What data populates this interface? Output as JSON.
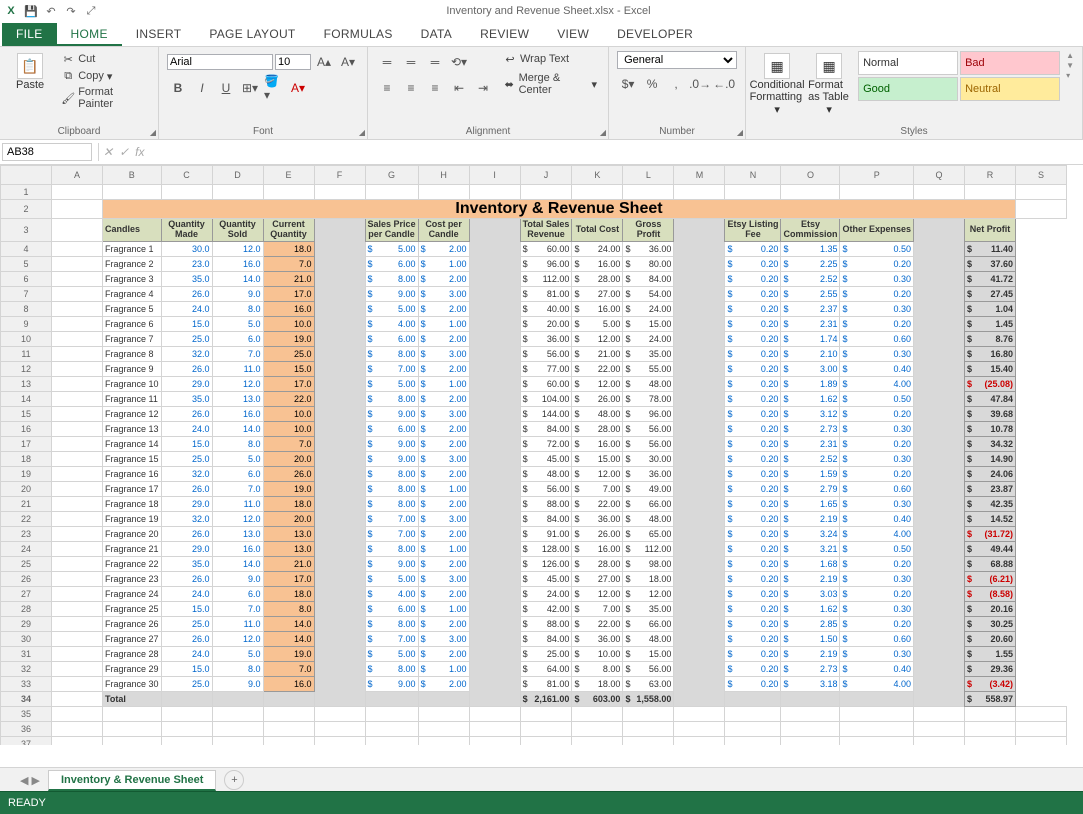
{
  "app": {
    "title": "Inventory and Revenue Sheet.xlsx - Excel",
    "qat_icons": [
      "excel-icon",
      "save-icon",
      "undo-icon",
      "redo-icon",
      "touch-icon"
    ]
  },
  "ribbon_tabs": [
    "FILE",
    "HOME",
    "INSERT",
    "PAGE LAYOUT",
    "FORMULAS",
    "DATA",
    "REVIEW",
    "VIEW",
    "DEVELOPER"
  ],
  "ribbon": {
    "clipboard": {
      "paste": "Paste",
      "cut": "Cut",
      "copy": "Copy",
      "painter": "Format Painter",
      "title": "Clipboard"
    },
    "font": {
      "name": "Arial",
      "size": "10",
      "bold": "B",
      "italic": "I",
      "underline": "U",
      "title": "Font"
    },
    "alignment": {
      "wrap": "Wrap Text",
      "merge": "Merge & Center",
      "title": "Alignment"
    },
    "number": {
      "format": "General",
      "title": "Number"
    },
    "styles": {
      "cond": "Conditional Formatting",
      "table": "Format as Table",
      "normal": "Normal",
      "bad": "Bad",
      "good": "Good",
      "neutral": "Neutral",
      "title": "Styles"
    }
  },
  "namebox": "AB38",
  "sheet": {
    "title": "Inventory & Revenue Sheet",
    "headers": [
      "Candles",
      "Quantity Made",
      "Quantity Sold",
      "Current Quantity",
      "Sales Price per Candle",
      "Cost per Candle",
      "Total Sales Revenue",
      "Total Cost",
      "Gross Profit",
      "Etsy Listing Fee",
      "Etsy Commission",
      "Other Expenses",
      "Net Profit"
    ],
    "cols": [
      "A",
      "B",
      "C",
      "D",
      "E",
      "F",
      "G",
      "H",
      "I",
      "J",
      "K",
      "L",
      "M",
      "N",
      "O",
      "P",
      "Q",
      "R",
      "S"
    ],
    "rows": [
      {
        "n": "Fragrance 1",
        "qm": 30.0,
        "qs": 12.0,
        "cq": 18.0,
        "sp": 5.0,
        "cp": 2.0,
        "rev": 60.0,
        "tc": 24.0,
        "gp": 36.0,
        "elf": 0.2,
        "ec": 1.35,
        "oe": 0.5,
        "np": 11.4
      },
      {
        "n": "Fragrance 2",
        "qm": 23.0,
        "qs": 16.0,
        "cq": 7.0,
        "sp": 6.0,
        "cp": 1.0,
        "rev": 96.0,
        "tc": 16.0,
        "gp": 80.0,
        "elf": 0.2,
        "ec": 2.25,
        "oe": 0.2,
        "np": 37.6
      },
      {
        "n": "Fragrance 3",
        "qm": 35.0,
        "qs": 14.0,
        "cq": 21.0,
        "sp": 8.0,
        "cp": 2.0,
        "rev": 112.0,
        "tc": 28.0,
        "gp": 84.0,
        "elf": 0.2,
        "ec": 2.52,
        "oe": 0.3,
        "np": 41.72
      },
      {
        "n": "Fragrance 4",
        "qm": 26.0,
        "qs": 9.0,
        "cq": 17.0,
        "sp": 9.0,
        "cp": 3.0,
        "rev": 81.0,
        "tc": 27.0,
        "gp": 54.0,
        "elf": 0.2,
        "ec": 2.55,
        "oe": 0.2,
        "np": 27.45
      },
      {
        "n": "Fragrance 5",
        "qm": 24.0,
        "qs": 8.0,
        "cq": 16.0,
        "sp": 5.0,
        "cp": 2.0,
        "rev": 40.0,
        "tc": 16.0,
        "gp": 24.0,
        "elf": 0.2,
        "ec": 2.37,
        "oe": 0.3,
        "np": 1.04
      },
      {
        "n": "Fragrance 6",
        "qm": 15.0,
        "qs": 5.0,
        "cq": 10.0,
        "sp": 4.0,
        "cp": 1.0,
        "rev": 20.0,
        "tc": 5.0,
        "gp": 15.0,
        "elf": 0.2,
        "ec": 2.31,
        "oe": 0.2,
        "np": 1.45
      },
      {
        "n": "Fragrance 7",
        "qm": 25.0,
        "qs": 6.0,
        "cq": 19.0,
        "sp": 6.0,
        "cp": 2.0,
        "rev": 36.0,
        "tc": 12.0,
        "gp": 24.0,
        "elf": 0.2,
        "ec": 1.74,
        "oe": 0.6,
        "np": 8.76
      },
      {
        "n": "Fragrance 8",
        "qm": 32.0,
        "qs": 7.0,
        "cq": 25.0,
        "sp": 8.0,
        "cp": 3.0,
        "rev": 56.0,
        "tc": 21.0,
        "gp": 35.0,
        "elf": 0.2,
        "ec": 2.1,
        "oe": 0.3,
        "np": 16.8
      },
      {
        "n": "Fragrance 9",
        "qm": 26.0,
        "qs": 11.0,
        "cq": 15.0,
        "sp": 7.0,
        "cp": 2.0,
        "rev": 77.0,
        "tc": 22.0,
        "gp": 55.0,
        "elf": 0.2,
        "ec": 3.0,
        "oe": 0.4,
        "np": 15.4
      },
      {
        "n": "Fragrance 10",
        "qm": 29.0,
        "qs": 12.0,
        "cq": 17.0,
        "sp": 5.0,
        "cp": 1.0,
        "rev": 60.0,
        "tc": 12.0,
        "gp": 48.0,
        "elf": 0.2,
        "ec": 1.89,
        "oe": 4.0,
        "np": -25.08
      },
      {
        "n": "Fragrance 11",
        "qm": 35.0,
        "qs": 13.0,
        "cq": 22.0,
        "sp": 8.0,
        "cp": 2.0,
        "rev": 104.0,
        "tc": 26.0,
        "gp": 78.0,
        "elf": 0.2,
        "ec": 1.62,
        "oe": 0.5,
        "np": 47.84
      },
      {
        "n": "Fragrance 12",
        "qm": 26.0,
        "qs": 16.0,
        "cq": 10.0,
        "sp": 9.0,
        "cp": 3.0,
        "rev": 144.0,
        "tc": 48.0,
        "gp": 96.0,
        "elf": 0.2,
        "ec": 3.12,
        "oe": 0.2,
        "np": 39.68
      },
      {
        "n": "Fragrance 13",
        "qm": 24.0,
        "qs": 14.0,
        "cq": 10.0,
        "sp": 6.0,
        "cp": 2.0,
        "rev": 84.0,
        "tc": 28.0,
        "gp": 56.0,
        "elf": 0.2,
        "ec": 2.73,
        "oe": 0.3,
        "np": 10.78
      },
      {
        "n": "Fragrance 14",
        "qm": 15.0,
        "qs": 8.0,
        "cq": 7.0,
        "sp": 9.0,
        "cp": 2.0,
        "rev": 72.0,
        "tc": 16.0,
        "gp": 56.0,
        "elf": 0.2,
        "ec": 2.31,
        "oe": 0.2,
        "np": 34.32
      },
      {
        "n": "Fragrance 15",
        "qm": 25.0,
        "qs": 5.0,
        "cq": 20.0,
        "sp": 9.0,
        "cp": 3.0,
        "rev": 45.0,
        "tc": 15.0,
        "gp": 30.0,
        "elf": 0.2,
        "ec": 2.52,
        "oe": 0.3,
        "np": 14.9
      },
      {
        "n": "Fragrance 16",
        "qm": 32.0,
        "qs": 6.0,
        "cq": 26.0,
        "sp": 8.0,
        "cp": 2.0,
        "rev": 48.0,
        "tc": 12.0,
        "gp": 36.0,
        "elf": 0.2,
        "ec": 1.59,
        "oe": 0.2,
        "np": 24.06
      },
      {
        "n": "Fragrance 17",
        "qm": 26.0,
        "qs": 7.0,
        "cq": 19.0,
        "sp": 8.0,
        "cp": 1.0,
        "rev": 56.0,
        "tc": 7.0,
        "gp": 49.0,
        "elf": 0.2,
        "ec": 2.79,
        "oe": 0.6,
        "np": 23.87
      },
      {
        "n": "Fragrance 18",
        "qm": 29.0,
        "qs": 11.0,
        "cq": 18.0,
        "sp": 8.0,
        "cp": 2.0,
        "rev": 88.0,
        "tc": 22.0,
        "gp": 66.0,
        "elf": 0.2,
        "ec": 1.65,
        "oe": 0.3,
        "np": 42.35
      },
      {
        "n": "Fragrance 19",
        "qm": 32.0,
        "qs": 12.0,
        "cq": 20.0,
        "sp": 7.0,
        "cp": 3.0,
        "rev": 84.0,
        "tc": 36.0,
        "gp": 48.0,
        "elf": 0.2,
        "ec": 2.19,
        "oe": 0.4,
        "np": 14.52
      },
      {
        "n": "Fragrance 20",
        "qm": 26.0,
        "qs": 13.0,
        "cq": 13.0,
        "sp": 7.0,
        "cp": 2.0,
        "rev": 91.0,
        "tc": 26.0,
        "gp": 65.0,
        "elf": 0.2,
        "ec": 3.24,
        "oe": 4.0,
        "np": -31.72
      },
      {
        "n": "Fragrance 21",
        "qm": 29.0,
        "qs": 16.0,
        "cq": 13.0,
        "sp": 8.0,
        "cp": 1.0,
        "rev": 128.0,
        "tc": 16.0,
        "gp": 112.0,
        "elf": 0.2,
        "ec": 3.21,
        "oe": 0.5,
        "np": 49.44
      },
      {
        "n": "Fragrance 22",
        "qm": 35.0,
        "qs": 14.0,
        "cq": 21.0,
        "sp": 9.0,
        "cp": 2.0,
        "rev": 126.0,
        "tc": 28.0,
        "gp": 98.0,
        "elf": 0.2,
        "ec": 1.68,
        "oe": 0.2,
        "np": 68.88
      },
      {
        "n": "Fragrance 23",
        "qm": 26.0,
        "qs": 9.0,
        "cq": 17.0,
        "sp": 5.0,
        "cp": 3.0,
        "rev": 45.0,
        "tc": 27.0,
        "gp": 18.0,
        "elf": 0.2,
        "ec": 2.19,
        "oe": 0.3,
        "np": -6.21
      },
      {
        "n": "Fragrance 24",
        "qm": 24.0,
        "qs": 6.0,
        "cq": 18.0,
        "sp": 4.0,
        "cp": 2.0,
        "rev": 24.0,
        "tc": 12.0,
        "gp": 12.0,
        "elf": 0.2,
        "ec": 3.03,
        "oe": 0.2,
        "np": -8.58
      },
      {
        "n": "Fragrance 25",
        "qm": 15.0,
        "qs": 7.0,
        "cq": 8.0,
        "sp": 6.0,
        "cp": 1.0,
        "rev": 42.0,
        "tc": 7.0,
        "gp": 35.0,
        "elf": 0.2,
        "ec": 1.62,
        "oe": 0.3,
        "np": 20.16
      },
      {
        "n": "Fragrance 26",
        "qm": 25.0,
        "qs": 11.0,
        "cq": 14.0,
        "sp": 8.0,
        "cp": 2.0,
        "rev": 88.0,
        "tc": 22.0,
        "gp": 66.0,
        "elf": 0.2,
        "ec": 2.85,
        "oe": 0.2,
        "np": 30.25
      },
      {
        "n": "Fragrance 27",
        "qm": 26.0,
        "qs": 12.0,
        "cq": 14.0,
        "sp": 7.0,
        "cp": 3.0,
        "rev": 84.0,
        "tc": 36.0,
        "gp": 48.0,
        "elf": 0.2,
        "ec": 1.5,
        "oe": 0.6,
        "np": 20.6
      },
      {
        "n": "Fragrance 28",
        "qm": 24.0,
        "qs": 5.0,
        "cq": 19.0,
        "sp": 5.0,
        "cp": 2.0,
        "rev": 25.0,
        "tc": 10.0,
        "gp": 15.0,
        "elf": 0.2,
        "ec": 2.19,
        "oe": 0.3,
        "np": 1.55
      },
      {
        "n": "Fragrance 29",
        "qm": 15.0,
        "qs": 8.0,
        "cq": 7.0,
        "sp": 8.0,
        "cp": 1.0,
        "rev": 64.0,
        "tc": 8.0,
        "gp": 56.0,
        "elf": 0.2,
        "ec": 2.73,
        "oe": 0.4,
        "np": 29.36
      },
      {
        "n": "Fragrance 30",
        "qm": 25.0,
        "qs": 9.0,
        "cq": 16.0,
        "sp": 9.0,
        "cp": 2.0,
        "rev": 81.0,
        "tc": 18.0,
        "gp": 63.0,
        "elf": 0.2,
        "ec": 3.18,
        "oe": 4.0,
        "np": -3.42
      }
    ],
    "total": {
      "label": "Total",
      "rev": 2161.0,
      "tc": 603.0,
      "gp": 1558.0,
      "np": 558.97
    }
  },
  "sheet_tab": "Inventory & Revenue Sheet",
  "status": "READY"
}
